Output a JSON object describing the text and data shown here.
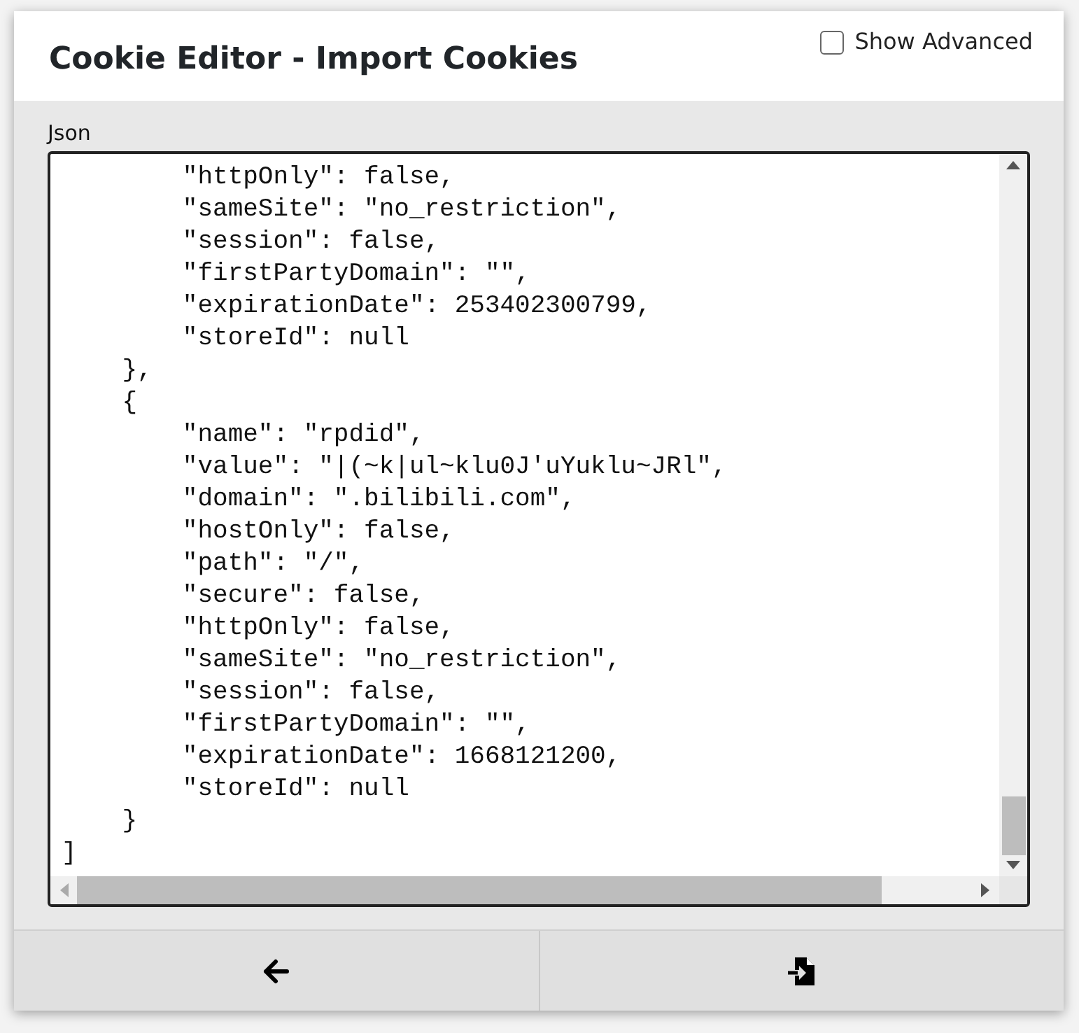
{
  "dialog": {
    "title": "Cookie Editor - Import Cookies"
  },
  "show_advanced": {
    "label": "Show Advanced",
    "checked": false
  },
  "json_field": {
    "label": "Json",
    "lines": [
      "        \"httpOnly\": false,",
      "        \"sameSite\": \"no_restriction\",",
      "        \"session\": false,",
      "        \"firstPartyDomain\": \"\",",
      "        \"expirationDate\": 253402300799,",
      "        \"storeId\": null",
      "    },",
      "    {",
      "        \"name\": \"rpdid\",",
      "        \"value\": \"|(~k|ul~klu0J'uYuklu~JRl\",",
      "        \"domain\": \".bilibili.com\",",
      "        \"hostOnly\": false,",
      "        \"path\": \"/\",",
      "        \"secure\": false,",
      "        \"httpOnly\": false,",
      "        \"sameSite\": \"no_restriction\",",
      "        \"session\": false,",
      "        \"firstPartyDomain\": \"\",",
      "        \"expirationDate\": 1668121200,",
      "        \"storeId\": null",
      "    }",
      "]"
    ]
  },
  "footer_buttons": [
    {
      "kind": "back"
    },
    {
      "kind": "import"
    }
  ]
}
